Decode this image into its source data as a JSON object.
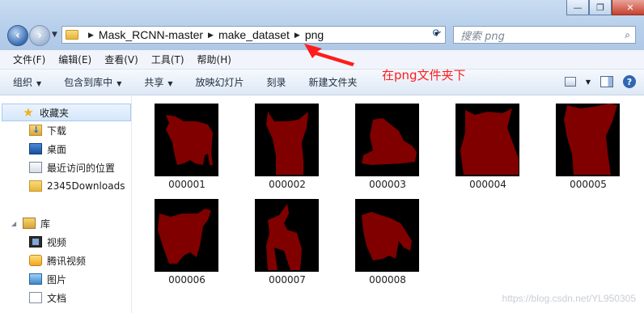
{
  "window": {
    "minimize": "—",
    "maximize": "❐",
    "close": "✕"
  },
  "address": {
    "crumbs": [
      "Mask_RCNN-master",
      "make_dataset",
      "png"
    ]
  },
  "search": {
    "placeholder": "搜索 png"
  },
  "menu": [
    "文件(F)",
    "编辑(E)",
    "查看(V)",
    "工具(T)",
    "帮助(H)"
  ],
  "commands": {
    "organize": "组织",
    "include_in_library": "包含到库中",
    "share": "共享",
    "slideshow": "放映幻灯片",
    "burn": "刻录",
    "new_folder": "新建文件夹"
  },
  "annotation": {
    "text": "在png文件夹下",
    "color": "#ff1c1c"
  },
  "sidebar": {
    "favorites_header": "收藏夹",
    "favorites": [
      "下载",
      "桌面",
      "最近访问的位置",
      "2345Downloads"
    ],
    "libraries_header": "库",
    "libraries": [
      "视频",
      "腾讯视频",
      "图片",
      "文档"
    ]
  },
  "files": [
    {
      "name": "000001",
      "shape": "cow"
    },
    {
      "name": "000002",
      "shape": "cat-face"
    },
    {
      "name": "000003",
      "shape": "dog-lying"
    },
    {
      "name": "000004",
      "shape": "cat-bust"
    },
    {
      "name": "000005",
      "shape": "cat-bust-tall"
    },
    {
      "name": "000006",
      "shape": "cow-standing"
    },
    {
      "name": "000007",
      "shape": "horse"
    },
    {
      "name": "000008",
      "shape": "bull"
    }
  ],
  "mask_color": "#800000",
  "watermark": "https://blog.csdn.net/YL950305"
}
